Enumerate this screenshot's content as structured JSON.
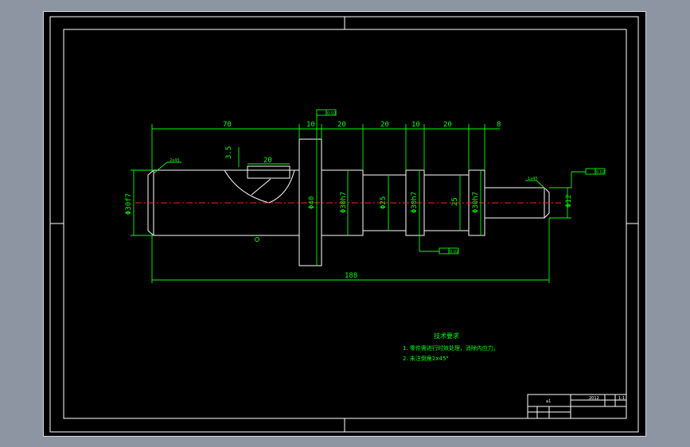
{
  "drawing": {
    "dimensions": {
      "d70": "70",
      "d10a": "10",
      "d20a": "20",
      "d20b": "20",
      "d10b": "10",
      "d20c": "20",
      "d8": "8",
      "d188": "188",
      "d20key": "20",
      "d35": "3.5",
      "dia_shaft_left": "Φ30f7",
      "dia_collar": "Φ40",
      "dia_h7a": "Φ30h7",
      "dia_25a": "Φ25",
      "dia_h7b": "Φ30h7",
      "dia_25b": "25",
      "dia_h7c": "Φ30h7",
      "dia_12": "Φ12"
    },
    "tolerances": {
      "top": "0.02",
      "bottom": "0.02",
      "right": "0.02"
    },
    "notes": {
      "title": "技术要求",
      "line1": "1. 零件需进行时效处理，消除内应力。",
      "line2": "2. 未注倒角2x45°"
    },
    "small_labels": {
      "left_chamfer": "2x45",
      "right_chamfer": "1x45"
    },
    "title_block": {
      "cell1": "a1",
      "cell2": "2012",
      "cell3": "1:1"
    },
    "colors": {
      "background": "#000000",
      "outline": "#ffffff",
      "dimension": "#00ff00",
      "centerline": "#ff2020"
    }
  }
}
